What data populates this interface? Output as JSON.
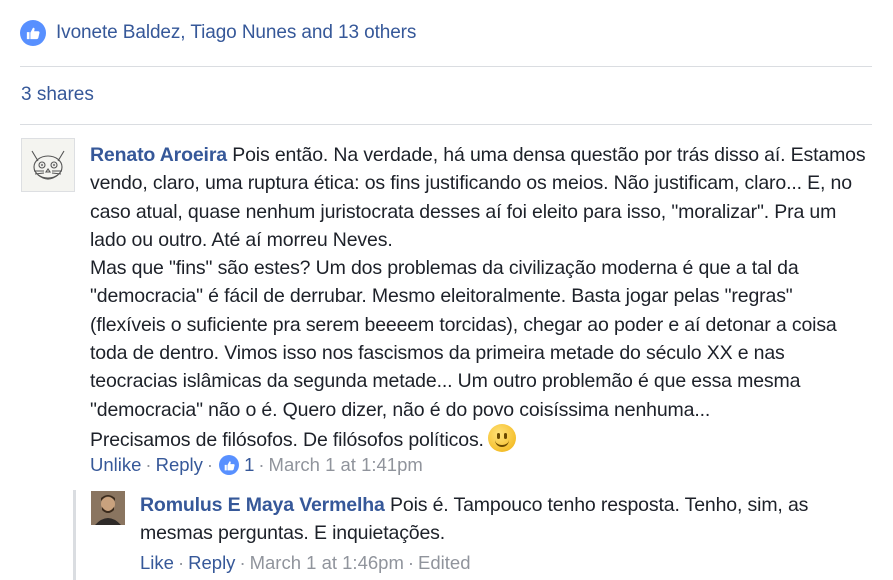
{
  "reactions": {
    "likes_text": "Ivonete Baldez, Tiago Nunes and 13 others",
    "shares_text": "3 shares"
  },
  "comment": {
    "author": "Renato Aroeira",
    "paragraph1": "Pois então. Na verdade, há uma densa questão por trás disso aí. Estamos vendo, claro, uma ruptura ética: os fins justificando os meios. Não justificam, claro... E, no caso atual, quase nenhum juristocrata desses aí foi eleito para isso, \"moralizar\". Pra um lado ou outro. Até aí morreu Neves.",
    "paragraph2": "Mas que \"fins\" são estes? Um dos problemas da civilização moderna é que a tal da \"democracia\" é fácil de derrubar. Mesmo eleitoralmente. Basta jogar pelas \"regras\" (flexíveis o suficiente pra serem beeeem torcidas), chegar ao poder e aí detonar a coisa toda de dentro. Vimos isso nos fascismos da primeira metade do século XX e nas teocracias islâmicas da segunda metade... Um outro problemão é que essa mesma \"democracia\" não o é. Quero dizer, não é do povo coisíssima nenhuma...",
    "paragraph3": "Precisamos de filósofos. De filósofos políticos.",
    "emoji": "smile-emoji",
    "unlike_label": "Unlike",
    "reply_label": "Reply",
    "like_count": "1",
    "timestamp": "March 1 at 1:41pm"
  },
  "reply": {
    "author": "Romulus E Maya Vermelha",
    "text": "Pois é. Tampouco tenho resposta. Tenho, sim, as mesmas perguntas. E inquietações.",
    "like_label": "Like",
    "reply_label": "Reply",
    "timestamp": "March 1 at 1:46pm",
    "edited_label": "Edited"
  },
  "colors": {
    "link": "#365899",
    "meta": "#90949c",
    "like_blue": "#5890ff",
    "text": "#1d2129"
  }
}
